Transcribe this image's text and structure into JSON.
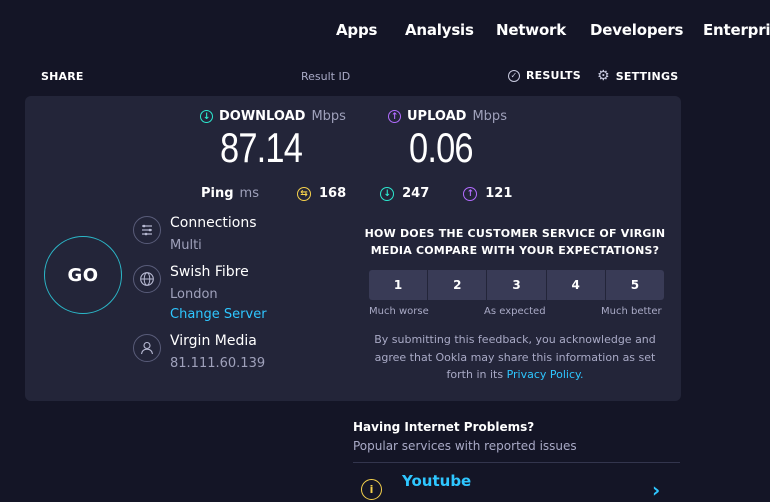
{
  "nav": {
    "items": [
      "Apps",
      "Analysis",
      "Network",
      "Developers",
      "Enterpris"
    ]
  },
  "subheader": {
    "share": "SHARE",
    "result_id": "Result ID",
    "results": "RESULTS",
    "settings": "SETTINGS"
  },
  "download": {
    "label": "DOWNLOAD",
    "unit": "Mbps",
    "value": "87.14"
  },
  "upload": {
    "label": "UPLOAD",
    "unit": "Mbps",
    "value": "0.06"
  },
  "ping": {
    "label": "Ping",
    "unit": "ms",
    "idle": "168",
    "download": "247",
    "upload": "121"
  },
  "go": {
    "label": "GO"
  },
  "connections": {
    "title": "Connections",
    "value": "Multi"
  },
  "server": {
    "name": "Swish Fibre",
    "location": "London",
    "change": "Change Server"
  },
  "isp": {
    "name": "Virgin Media",
    "ip": "81.111.60.139"
  },
  "survey": {
    "question": "HOW DOES THE CUSTOMER SERVICE OF VIRGIN MEDIA COMPARE WITH YOUR EXPECTATIONS?",
    "ratings": [
      "1",
      "2",
      "3",
      "4",
      "5"
    ],
    "low": "Much worse",
    "mid": "As expected",
    "high": "Much better",
    "disclaimer": "By submitting this feedback, you acknowledge and agree that Ookla may share this information as set forth in its",
    "privacy_link": "Privacy Policy."
  },
  "problems": {
    "title": "Having Internet Problems?",
    "subtitle": "Popular services with reported issues",
    "first_service": "Youtube"
  },
  "colors": {
    "background": "#141526",
    "panel": "#232539",
    "download": "#2ce8cf",
    "upload": "#b26cff",
    "ping_idle": "#f5d14b",
    "link": "#2ec6ff"
  }
}
